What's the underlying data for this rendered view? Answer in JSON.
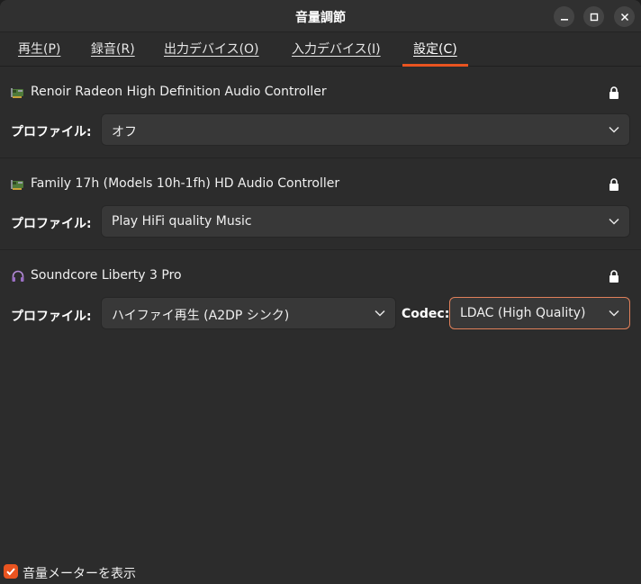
{
  "window": {
    "title": "音量調節"
  },
  "tabs": [
    {
      "label": "再生(P)"
    },
    {
      "label": "録音(R)"
    },
    {
      "label": "出力デバイス(O)"
    },
    {
      "label": "入力デバイス(I)"
    },
    {
      "label": "設定(C)"
    }
  ],
  "active_tab": "設定(C)",
  "devices": [
    {
      "icon": "sound-card-icon",
      "name": "Renoir Radeon High Definition Audio Controller",
      "profile_label": "プロファイル:",
      "profile_value": "オフ"
    },
    {
      "icon": "sound-card-icon",
      "name": "Family 17h (Models 10h-1fh) HD Audio Controller",
      "profile_label": "プロファイル:",
      "profile_value": "Play HiFi quality Music"
    },
    {
      "icon": "headphones-icon",
      "name": "Soundcore Liberty 3 Pro",
      "profile_label": "プロファイル:",
      "profile_value": "ハイファイ再生 (A2DP シンク)",
      "codec_label": "Codec:",
      "codec_value": "LDAC (High Quality)"
    }
  ],
  "footer": {
    "show_meters_label": "音量メーターを表示",
    "show_meters_checked": true
  },
  "colors": {
    "accent": "#e95420",
    "background": "#2c2c2c"
  }
}
